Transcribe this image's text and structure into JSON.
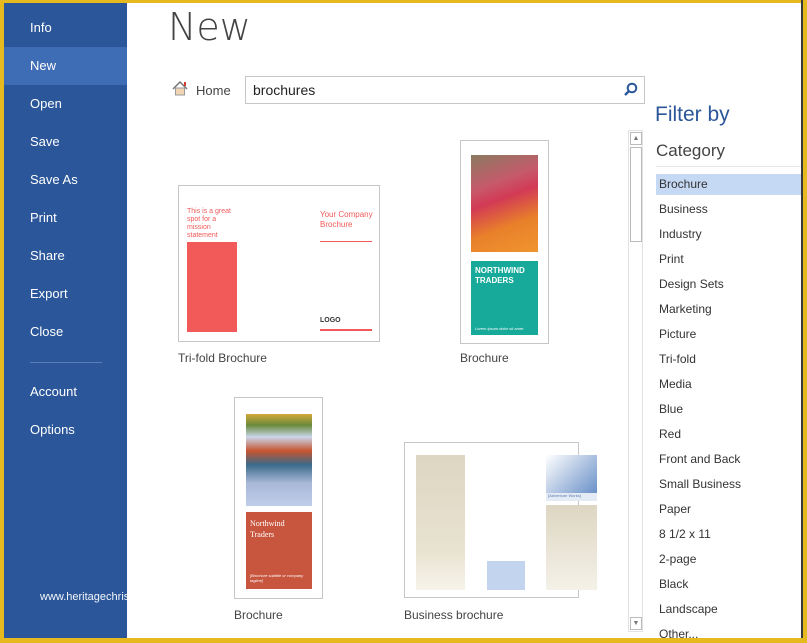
{
  "sidebar": {
    "items": [
      {
        "label": "Info"
      },
      {
        "label": "New",
        "selected": true
      },
      {
        "label": "Open"
      },
      {
        "label": "Save"
      },
      {
        "label": "Save As"
      },
      {
        "label": "Print"
      },
      {
        "label": "Share"
      },
      {
        "label": "Export"
      },
      {
        "label": "Close"
      },
      {
        "label": "Account"
      },
      {
        "label": "Options"
      }
    ]
  },
  "watermark": "www.heritagechristiancollege.com",
  "header": {
    "title": "New",
    "home_label": "Home"
  },
  "search": {
    "value": "brochures",
    "icon": "search-icon"
  },
  "templates": [
    {
      "label": "Tri-fold Brochure",
      "mission": "This is a great spot for a mission statement",
      "company": "Your Company Brochure",
      "logo": "LOGO"
    },
    {
      "label": "Brochure",
      "heading": "NORTHWIND TRADERS",
      "tagline": "Lorem ipsum dolor sit amet."
    },
    {
      "label": "Brochure",
      "heading": "Northwind Traders",
      "tagline": "[Brochure subtitle or company tagline]"
    },
    {
      "label": "Business brochure",
      "heading": "[Adventure Works]"
    }
  ],
  "filter": {
    "title": "Filter by",
    "category_title": "Category",
    "categories": [
      "Brochure",
      "Business",
      "Industry",
      "Print",
      "Design Sets",
      "Marketing",
      "Picture",
      "Tri-fold",
      "Media",
      "Blue",
      "Red",
      "Front and Back",
      "Small Business",
      "Paper",
      "8 1/2 x 11",
      "2-page",
      "Black",
      "Landscape",
      "Other..."
    ],
    "selected": "Brochure"
  },
  "colors": {
    "sidebar": "#2b579a",
    "sidebar_selected": "#3e6db5",
    "accent_red": "#f25a5a",
    "teal": "#17a99a",
    "rust": "#c8553d",
    "frame": "#e6b91e"
  }
}
